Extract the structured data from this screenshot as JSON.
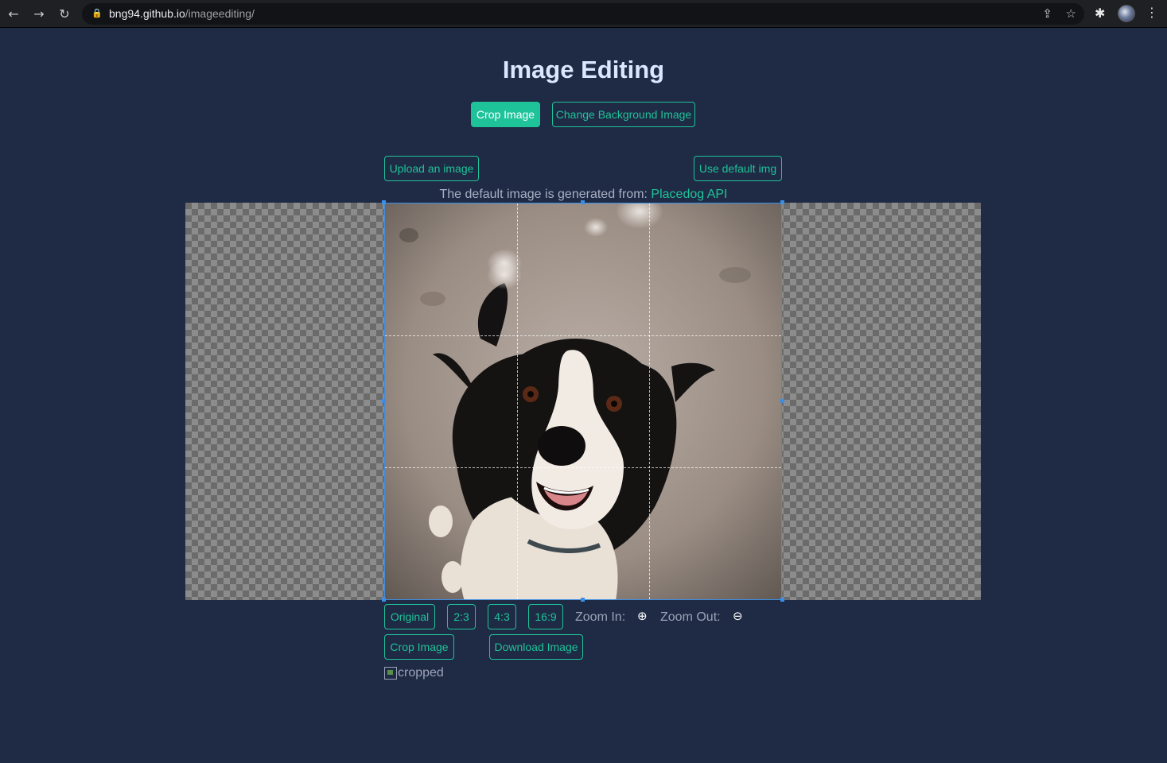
{
  "browser": {
    "url_host": "bng94.github.io",
    "url_path": "/imageediting/",
    "back_icon": "←",
    "forward_icon": "→",
    "reload_icon": "↻",
    "lock_icon": "🔒",
    "share_icon": "⇪",
    "star_icon": "☆",
    "extension_icon": "✱",
    "menu_icon": "⋮"
  },
  "page": {
    "title": "Image Editing",
    "tabs": {
      "crop": "Crop Image",
      "change_bg": "Change Background Image"
    },
    "upload_label": "Upload an image",
    "default_img_label": "Use default img",
    "credit_text": "The default image is generated from: ",
    "credit_link": "Placedog API",
    "ratios": [
      "Original",
      "2:3",
      "4:3",
      "16:9"
    ],
    "zoom_in_label": "Zoom In:",
    "zoom_out_label": "Zoom Out:",
    "zoom_in_icon": "⊕",
    "zoom_out_icon": "⊖",
    "crop_button": "Crop Image",
    "download_button": "Download Image",
    "cropped_alt": "cropped"
  },
  "colors": {
    "background": "#1f2a44",
    "accent": "#1fc39a",
    "crop_border": "#3a8ee6"
  }
}
